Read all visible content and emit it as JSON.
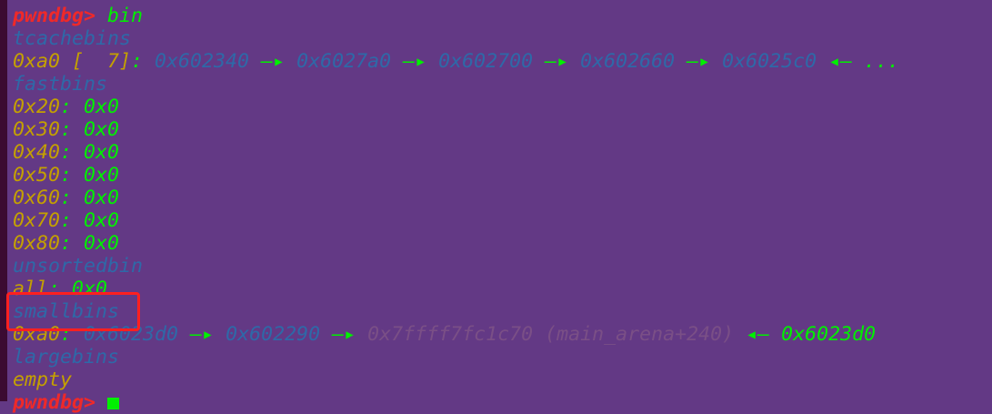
{
  "colors": {
    "background": "#633985",
    "prompt": "#ef2929",
    "value": "#00f000",
    "label": "#c4a000",
    "address": "#2e69a8",
    "dim": "#7a4f86",
    "highlight": "#ff2020"
  },
  "terminal": {
    "lines": [
      {
        "segs": [
          {
            "t": "",
            "c": "plain"
          }
        ]
      },
      {
        "segs": [
          {
            "t": "pwndbg> ",
            "c": "prompt"
          },
          {
            "t": "bin",
            "c": "green"
          }
        ]
      },
      {
        "segs": [
          {
            "t": "tcachebins",
            "c": "blue"
          }
        ]
      },
      {
        "segs": [
          {
            "t": "0xa0 [  7]",
            "c": "yellow"
          },
          {
            "t": ": ",
            "c": "green"
          },
          {
            "t": "0x602340",
            "c": "blue"
          },
          {
            "t": " —▸ ",
            "c": "green"
          },
          {
            "t": "0x6027a0",
            "c": "blue"
          },
          {
            "t": " —▸ ",
            "c": "green"
          },
          {
            "t": "0x602700",
            "c": "blue"
          },
          {
            "t": " —▸ ",
            "c": "green"
          },
          {
            "t": "0x602660",
            "c": "blue"
          },
          {
            "t": " —▸ ",
            "c": "green"
          },
          {
            "t": "0x6025c0",
            "c": "blue"
          },
          {
            "t": " ◂— ...",
            "c": "green"
          }
        ]
      },
      {
        "segs": [
          {
            "t": "fastbins",
            "c": "blue"
          }
        ]
      },
      {
        "segs": [
          {
            "t": "0x20",
            "c": "yellow"
          },
          {
            "t": ": 0x0",
            "c": "green"
          }
        ]
      },
      {
        "segs": [
          {
            "t": "0x30",
            "c": "yellow"
          },
          {
            "t": ": 0x0",
            "c": "green"
          }
        ]
      },
      {
        "segs": [
          {
            "t": "0x40",
            "c": "yellow"
          },
          {
            "t": ": 0x0",
            "c": "green"
          }
        ]
      },
      {
        "segs": [
          {
            "t": "0x50",
            "c": "yellow"
          },
          {
            "t": ": 0x0",
            "c": "green"
          }
        ]
      },
      {
        "segs": [
          {
            "t": "0x60",
            "c": "yellow"
          },
          {
            "t": ": 0x0",
            "c": "green"
          }
        ]
      },
      {
        "segs": [
          {
            "t": "0x70",
            "c": "yellow"
          },
          {
            "t": ": 0x0",
            "c": "green"
          }
        ]
      },
      {
        "segs": [
          {
            "t": "0x80",
            "c": "yellow"
          },
          {
            "t": ": 0x0",
            "c": "green"
          }
        ]
      },
      {
        "segs": [
          {
            "t": "unsortedbin",
            "c": "blue"
          }
        ]
      },
      {
        "segs": [
          {
            "t": "all",
            "c": "yellow"
          },
          {
            "t": ": 0x0",
            "c": "green"
          }
        ]
      },
      {
        "segs": [
          {
            "t": "smallbins",
            "c": "blue"
          }
        ]
      },
      {
        "segs": [
          {
            "t": "0xa0",
            "c": "yellow"
          },
          {
            "t": ": ",
            "c": "green"
          },
          {
            "t": "0x6023d0",
            "c": "blue"
          },
          {
            "t": " —▸ ",
            "c": "green"
          },
          {
            "t": "0x602290",
            "c": "blue"
          },
          {
            "t": " —▸ ",
            "c": "green"
          },
          {
            "t": "0x7ffff7fc1c70 (main_arena+240)",
            "c": "dim"
          },
          {
            "t": " ◂— ",
            "c": "green"
          },
          {
            "t": "0x6023d0",
            "c": "green"
          }
        ]
      },
      {
        "segs": [
          {
            "t": "largebins",
            "c": "blue"
          }
        ]
      },
      {
        "segs": [
          {
            "t": "empty",
            "c": "yellow"
          }
        ]
      },
      {
        "segs": [
          {
            "t": "pwndbg> ",
            "c": "prompt"
          }
        ],
        "cursor": true
      }
    ]
  }
}
